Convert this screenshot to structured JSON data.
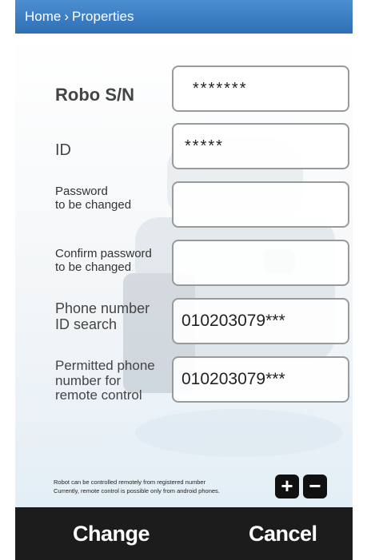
{
  "breadcrumb": {
    "home": "Home",
    "separator": "›",
    "current": "Properties"
  },
  "form": {
    "robo_sn": {
      "label": "Robo S/N",
      "value": "*******"
    },
    "id": {
      "label": "ID",
      "value": "*****"
    },
    "password": {
      "label": "Password\nto be changed",
      "value": ""
    },
    "confirm_password": {
      "label": "Confirm password\nto be changed",
      "value": ""
    },
    "phone_id_search": {
      "label": "Phone number\nID search",
      "value": "010203079***"
    },
    "permitted_phone": {
      "label": "Permitted phone\nnumber for\nremote control",
      "value": "010203079***"
    }
  },
  "note": {
    "line1": "Robot can be controlled remotely from registered number",
    "line2": "Currently, remote control is possible only from android phones."
  },
  "controls": {
    "plus": "+",
    "minus": "−"
  },
  "actions": {
    "change": "Change",
    "cancel": "Cancel"
  },
  "colors": {
    "header": "#3a7bc4",
    "bottom_bar": "#1c1c1c"
  }
}
